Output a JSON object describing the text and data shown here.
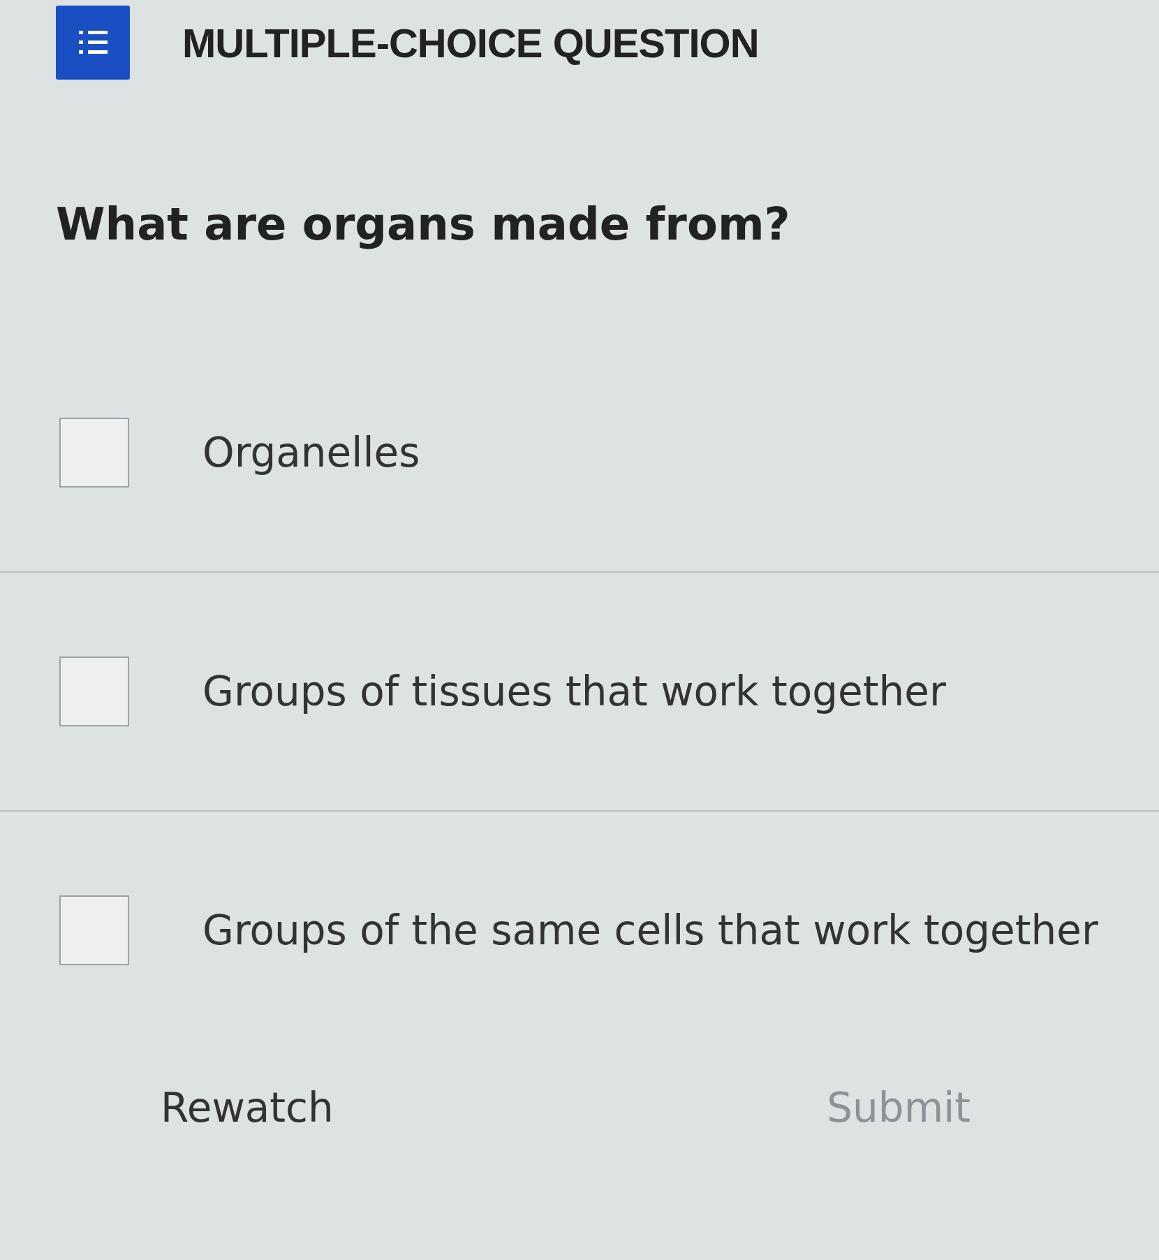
{
  "header": {
    "title": "MULTIPLE-CHOICE QUESTION"
  },
  "question": "What are organs made from?",
  "options": [
    {
      "label": "Organelles",
      "checked": false
    },
    {
      "label": "Groups of tissues that work together",
      "checked": false
    },
    {
      "label": "Groups of the same cells that work together",
      "checked": false
    }
  ],
  "buttons": [
    {
      "label": "Rewatch",
      "disabled": false
    },
    {
      "label": "Submit",
      "disabled": true
    }
  ]
}
